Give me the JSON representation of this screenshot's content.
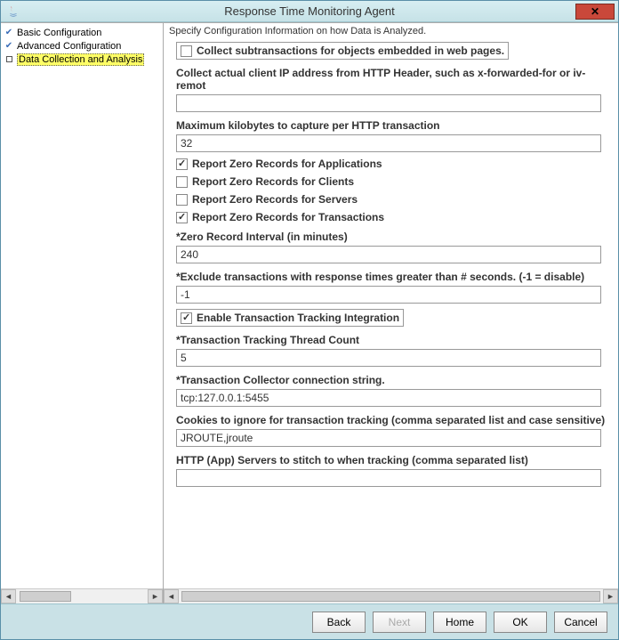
{
  "window": {
    "title": "Response Time Monitoring Agent"
  },
  "sidebar": {
    "items": [
      {
        "label": "Basic Configuration",
        "state": "checked"
      },
      {
        "label": "Advanced Configuration",
        "state": "checked"
      },
      {
        "label": "Data Collection and Analysis",
        "state": "box",
        "selected": true
      }
    ]
  },
  "main": {
    "description": "Specify Configuration Information on how Data is Analyzed."
  },
  "form": {
    "collect_subtx_label": "Collect subtransactions for objects embedded in web pages.",
    "collect_subtx_checked": false,
    "client_ip_label": "Collect actual client IP address from HTTP Header, such as x-forwarded-for or iv-remot",
    "client_ip_value": "",
    "max_kb_label": "Maximum kilobytes to capture per HTTP transaction",
    "max_kb_value": "32",
    "rzr_apps_label": "Report Zero Records for Applications",
    "rzr_apps_checked": true,
    "rzr_clients_label": "Report Zero Records for Clients",
    "rzr_clients_checked": false,
    "rzr_servers_label": "Report Zero Records for Servers",
    "rzr_servers_checked": false,
    "rzr_tx_label": "Report Zero Records for           Transactions",
    "rzr_tx_checked": true,
    "zero_interval_label": "*Zero Record Interval (in minutes)",
    "zero_interval_value": "240",
    "exclude_label": "*Exclude transactions with response times greater than # seconds. (-1 = disable)",
    "exclude_value": "-1",
    "enable_tt_label": "Enable Transaction Tracking Integration",
    "enable_tt_checked": true,
    "tt_thread_label": "*Transaction Tracking Thread Count",
    "tt_thread_value": "5",
    "tt_collector_label": "*Transaction Collector connection string.",
    "tt_collector_value": "tcp:127.0.0.1:5455",
    "cookies_label": "Cookies to ignore for transaction tracking (comma separated list and case sensitive)",
    "cookies_value": "JROUTE,jroute",
    "http_servers_label": "HTTP (App) Servers to stitch to when tracking (comma separated list)",
    "http_servers_value": ""
  },
  "footer": {
    "back": "Back",
    "next": "Next",
    "home": "Home",
    "ok": "OK",
    "cancel": "Cancel"
  }
}
